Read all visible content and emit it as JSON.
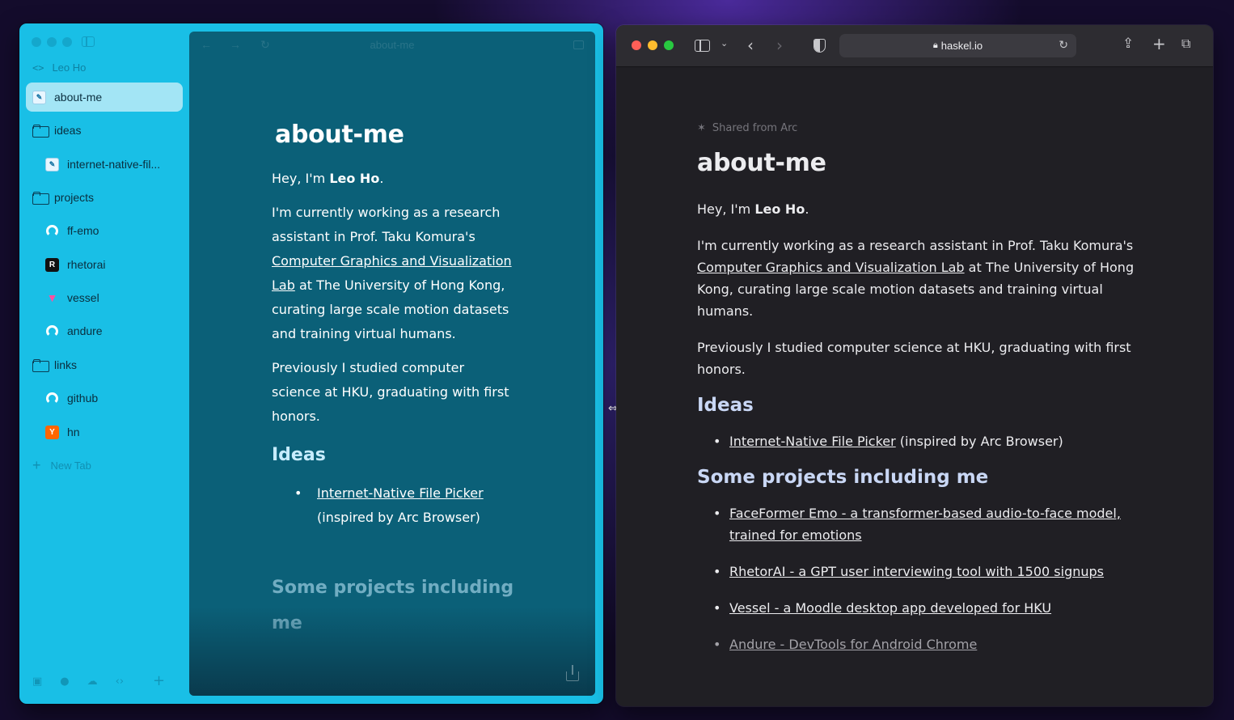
{
  "arc": {
    "url_text": "Leo Ho",
    "sidebar": {
      "items": [
        {
          "label": "about-me"
        },
        {
          "label": "ideas"
        },
        {
          "label": "internet-native-fil..."
        },
        {
          "label": "projects"
        },
        {
          "label": "ff-emo"
        },
        {
          "label": "rhetorai"
        },
        {
          "label": "vessel"
        },
        {
          "label": "andure"
        },
        {
          "label": "links"
        },
        {
          "label": "github"
        },
        {
          "label": "hn"
        }
      ],
      "new_tab": "New Tab"
    },
    "tab_title": "about-me",
    "doc": {
      "title": "about-me",
      "greeting_prefix": "Hey, I'm ",
      "greeting_name": "Leo Ho",
      "greeting_suffix": ".",
      "intro_a": "I'm currently working as a research assistant in Prof. Taku Komura's ",
      "intro_link": "Computer Graphics and Visualization Lab",
      "intro_b": " at The University of Hong Kong, curating large scale motion datasets and training virtual humans.",
      "previously": "Previously I studied computer science at HKU, graduating with first honors.",
      "ideas_heading": "Ideas",
      "idea_link": "Internet-Native File Picker",
      "idea_note": " (inspired by Arc Browser)",
      "projects_heading": "Some projects including me"
    }
  },
  "safari": {
    "url": "haskel.io",
    "doc": {
      "shared_from": "Shared from Arc",
      "title": "about-me",
      "greeting_prefix": "Hey, I'm ",
      "greeting_name": "Leo Ho",
      "greeting_suffix": ".",
      "intro_a": "I'm currently working as a research assistant in Prof. Taku Komura's ",
      "intro_link": "Computer Graphics and Visualization Lab",
      "intro_b": " at The University of Hong Kong, curating large scale motion datasets and training virtual humans.",
      "previously": "Previously I studied computer science at HKU, graduating with first honors.",
      "ideas_heading": "Ideas",
      "idea_link": "Internet-Native File Picker",
      "idea_note": " (inspired by Arc Browser)",
      "projects_heading": "Some projects including me",
      "projects": [
        {
          "label": "FaceFormer Emo - a transformer-based audio-to-face model, trained for emotions"
        },
        {
          "label": "RhetorAI - a GPT user interviewing tool with 1500 signups"
        },
        {
          "label": "Vessel - a Moodle desktop app developed for HKU"
        },
        {
          "label": "Andure - DevTools for Android Chrome"
        }
      ]
    }
  },
  "colors": {
    "arc_sidebar": "#19bfe6",
    "arc_content": "#0b6078",
    "safari_bg": "#201f24",
    "heading_accent": "#c9d7f5"
  }
}
